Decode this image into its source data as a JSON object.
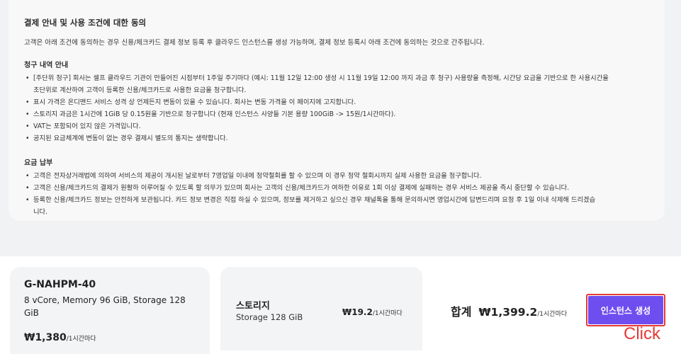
{
  "terms": {
    "title": "결제 안내 및 사용 조건에 대한 동의",
    "intro": "고객은 아래 조건에 동의하는 경우 신용/체크카드 결제 정보 등록 후 클라우드 인스턴스를 생성 가능하며, 결제 정보 등록시 아래 조건에 동의하는 것으로 간주됩니다.",
    "billing_title": "청구 내역 안내",
    "billing_items": [
      "[주단위 청구] 회사는 셀프 클라우드 기관이 만들어진 시점부터 1주일 주기마다 (예시: 11월 12일 12:00 생성 시 11월 19일 12:00 까지 과금 후 청구) 사용량을 측정해, 시간당 요금을 기반으로 한 사용시간을",
      "초단위로 계산하여 고객이 등록한 신용/체크카드로 사용한 요금을 청구합니다.",
      "표시 가격은 온디맨드 서비스 성격 상 언제든지 변동이 있을 수 있습니다. 회사는 변동 가격을 이 페이지에 고지합니다.",
      "스토리지 과금은 1시간에 1GiB 당 0.15원을 기반으로 청구합니다 (현재 인스턴스 사양들 기본 용량 100GiB -> 15원/1시간마다).",
      "VAT는 포함되어 있지 않은 가격입니다.",
      "공지된 요금체계에 변동이 없는 경우 결제시 별도의 통지는 생략합니다."
    ],
    "payment_title": "요금 납부",
    "payment_items": [
      "고객은 전자상거래법에 의하여 서비스의 제공이 개시된 날로부터 7영업일 이내에 청약철회를 할 수 있으며 이 경우 청약 철회시까지 실제 사용한 요금을 청구합니다.",
      "고객은 신용/체크카드의 결제가 원활하 이루어질 수 있도록 할 의무가 있으며 회사는 고객의 신용/체크카드가 여하한 이유로 1회 이상 결제에 실패하는 경우 서비스 제공을 즉시 중단할 수 있습니다.",
      "등록한 신용/체크카드 정보는 안전하게 보관됩니다. 카드 정보 변경은 직접 하실 수 있으며, 정보를 제거하고 싶으신 경우 채널톡을 통해 문의하시면 영업시간에 답변드리며 요청 후 1일 이내 삭제해 드리겠습",
      "니다."
    ]
  },
  "sku": {
    "name": "G-NAHPM-40",
    "spec": "8 vCore, Memory 96 GiB, Storage 128 GiB",
    "price": "₩1,380",
    "unit": "/1시간마다"
  },
  "storage": {
    "title": "스토리지",
    "size": "Storage 128 GiB",
    "price": "₩19.2",
    "unit": "/1시간마다"
  },
  "total": {
    "label": "합계",
    "price": "₩1,399.2",
    "unit": "/1시간마다"
  },
  "create_button": "인스턴스 생성",
  "click_label": "Click"
}
